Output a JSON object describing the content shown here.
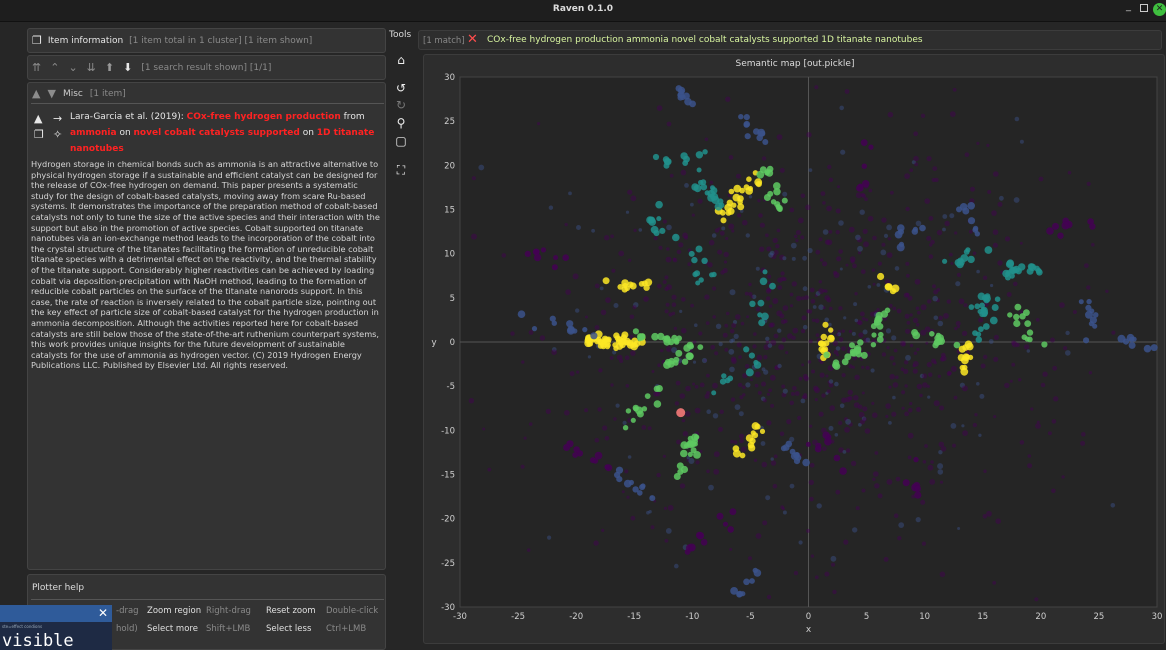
{
  "window": {
    "title": "Raven 0.1.0"
  },
  "info_header": {
    "label": "Item information",
    "summary": "[1 item total in 1 cluster] [1 item shown]"
  },
  "nav": {
    "results": "[1 search result shown] [1/1]"
  },
  "item_panel": {
    "group_label": "Misc",
    "group_count": "[1 item]",
    "authors_year": "Lara-Garcia et al. (2019): ",
    "title_parts": [
      {
        "text": "COx-free hydrogen production",
        "highlight": true
      },
      {
        "text": " from ",
        "highlight": false
      },
      {
        "text": "ammonia",
        "highlight": true
      },
      {
        "text": " on ",
        "highlight": false
      },
      {
        "text": "novel cobalt catalysts supported",
        "highlight": true
      },
      {
        "text": " on ",
        "highlight": false
      },
      {
        "text": "1D titanate nanotubes",
        "highlight": true
      }
    ],
    "abstract": "Hydrogen storage in chemical bonds such as ammonia is an attractive alternative to physical hydrogen storage if a sustainable and efficient catalyst can be designed for the release of COx-free hydrogen on demand. This paper presents a systematic study for the design of cobalt-based catalysts, moving away from scare Ru-based systems. It demonstrates the importance of the preparation method of cobalt-based catalysts not only to tune the size of the active species and their interaction with the support but also in the promotion of active species. Cobalt supported on titanate nanotubes via an ion-exchange method leads to the incorporation of the cobalt into the crystal structure of the titanates facilitating the formation of unreducible cobalt titanate species with a detrimental effect on the reactivity, and the thermal stability of the titanate support. Considerably higher reactivities can be achieved by loading cobalt via deposition-precipitation with NaOH method, leading to the formation of reducible cobalt particles on the surface of the titanate nanorods support. In this case, the rate of reaction is inversely related to the cobalt particle size, pointing out the key effect of particle size of cobalt-based catalyst for the hydrogen production in ammonia decomposition. Although the activities reported here for cobalt-based catalysts are still below those of the state-of-the-art ruthenium counterpart systems, this work provides unique insights for the future development of sustainable catalysts for the use of ammonia as hydrogen vector. (C) 2019 Hydrogen Energy Publications LLC. Published by Elsevier Ltd. All rights reserved."
  },
  "help": {
    "title": "Plotter help",
    "row1": [
      {
        "text": "-drag"
      },
      {
        "text": "Zoom region"
      },
      {
        "text": "Right-drag"
      },
      {
        "text": "Reset zoom"
      },
      {
        "text": "Double-click"
      }
    ],
    "row2": [
      {
        "text": "hold)"
      },
      {
        "text": "Select more"
      },
      {
        "text": "Shift+LMB"
      },
      {
        "text": "Select less"
      },
      {
        "text": "Ctrl+LMB"
      }
    ]
  },
  "tools": {
    "label": "Tools"
  },
  "search": {
    "count": "[1 match]",
    "query": "COx-free hydrogen production ammonia novel cobalt catalysts supported 1D titanate nanotubes"
  },
  "mini_window": {
    "tiny_text": "ste=effect     condions",
    "big_text": "visible"
  },
  "chart_data": {
    "type": "scatter",
    "title": "Semantic map [out.pickle]",
    "xlabel": "x",
    "ylabel": "y",
    "xlim": [
      -30,
      30
    ],
    "ylim": [
      -30,
      30
    ],
    "xticks": [
      -30,
      -25,
      -20,
      -15,
      -10,
      -5,
      0,
      5,
      10,
      15,
      20,
      25,
      30
    ],
    "yticks": [
      30,
      25,
      20,
      15,
      10,
      5,
      0,
      -5,
      -10,
      -15,
      -20,
      -25,
      -30
    ],
    "grid": false,
    "colormap": [
      "#440154",
      "#3b528b",
      "#21918c",
      "#5ec962",
      "#fde725"
    ],
    "highlight_color": "#e07070",
    "selected_point": {
      "x": -11,
      "y": -8
    },
    "clusters": [
      {
        "x": -16.5,
        "y": 0,
        "n": 40,
        "s": 1.5,
        "c": 4
      },
      {
        "x": -19,
        "y": 0,
        "n": 10,
        "s": 0.6,
        "c": 4
      },
      {
        "x": -15.5,
        "y": 6.5,
        "n": 12,
        "s": 1.2,
        "c": 4
      },
      {
        "x": -13,
        "y": 0.5,
        "n": 16,
        "s": 1.4,
        "c": 3
      },
      {
        "x": -11,
        "y": -1.5,
        "n": 14,
        "s": 1.2,
        "c": 3
      },
      {
        "x": -6,
        "y": 16.5,
        "n": 22,
        "s": 1.6,
        "c": 4
      },
      {
        "x": -3,
        "y": 17,
        "n": 16,
        "s": 1.6,
        "c": 3
      },
      {
        "x": -8.5,
        "y": 17,
        "n": 16,
        "s": 1.6,
        "c": 2
      },
      {
        "x": -10,
        "y": 21,
        "n": 10,
        "s": 1.6,
        "c": 2
      },
      {
        "x": -13,
        "y": 13,
        "n": 10,
        "s": 1.8,
        "c": 2
      },
      {
        "x": -10.5,
        "y": 27.5,
        "n": 10,
        "s": 1.0,
        "c": 1
      },
      {
        "x": -5,
        "y": 24,
        "n": 10,
        "s": 1.5,
        "c": 1
      },
      {
        "x": -9,
        "y": 8,
        "n": 10,
        "s": 2.0,
        "c": 2
      },
      {
        "x": -14,
        "y": -7,
        "n": 12,
        "s": 1.6,
        "c": 3
      },
      {
        "x": -10.5,
        "y": -13,
        "n": 18,
        "s": 1.6,
        "c": 3
      },
      {
        "x": -5,
        "y": -11,
        "n": 12,
        "s": 1.4,
        "c": 4
      },
      {
        "x": -1.5,
        "y": -12.5,
        "n": 10,
        "s": 1.2,
        "c": 1
      },
      {
        "x": -15,
        "y": -16,
        "n": 10,
        "s": 2.0,
        "c": 1
      },
      {
        "x": -19,
        "y": -13,
        "n": 10,
        "s": 1.6,
        "c": 0
      },
      {
        "x": -8,
        "y": -22,
        "n": 10,
        "s": 2.0,
        "c": 0
      },
      {
        "x": -5,
        "y": -27,
        "n": 8,
        "s": 1.6,
        "c": 1
      },
      {
        "x": 1.5,
        "y": 0,
        "n": 14,
        "s": 1.2,
        "c": 4
      },
      {
        "x": 3.5,
        "y": -1.5,
        "n": 14,
        "s": 1.4,
        "c": 3
      },
      {
        "x": 6,
        "y": 1,
        "n": 14,
        "s": 1.8,
        "c": 3
      },
      {
        "x": 11,
        "y": 0.5,
        "n": 12,
        "s": 1.4,
        "c": 3
      },
      {
        "x": 13.5,
        "y": -2,
        "n": 12,
        "s": 1.2,
        "c": 4
      },
      {
        "x": 15,
        "y": 3,
        "n": 22,
        "s": 1.8,
        "c": 2
      },
      {
        "x": 19,
        "y": 8,
        "n": 18,
        "s": 1.8,
        "c": 2
      },
      {
        "x": 14,
        "y": 10,
        "n": 10,
        "s": 1.6,
        "c": 2
      },
      {
        "x": 18.5,
        "y": 2,
        "n": 12,
        "s": 1.6,
        "c": 3
      },
      {
        "x": 24,
        "y": 3,
        "n": 10,
        "s": 2.0,
        "c": 1
      },
      {
        "x": 28,
        "y": 0,
        "n": 8,
        "s": 1.6,
        "c": 1
      },
      {
        "x": 8,
        "y": 12,
        "n": 8,
        "s": 2.0,
        "c": 1
      },
      {
        "x": 7,
        "y": 6.5,
        "n": 6,
        "s": 1.0,
        "c": 4
      },
      {
        "x": 14,
        "y": 14,
        "n": 8,
        "s": 2.0,
        "c": 1
      },
      {
        "x": 23,
        "y": 13,
        "n": 8,
        "s": 2.0,
        "c": 0
      },
      {
        "x": 2,
        "y": -13,
        "n": 8,
        "s": 2.0,
        "c": 0
      },
      {
        "x": 9,
        "y": -16,
        "n": 6,
        "s": 2.0,
        "c": 0
      },
      {
        "x": -22,
        "y": 2,
        "n": 10,
        "s": 2.0,
        "c": 1
      },
      {
        "x": -23,
        "y": 10,
        "n": 8,
        "s": 2.0,
        "c": 0
      },
      {
        "x": 5,
        "y": 20,
        "n": 6,
        "s": 2.0,
        "c": 0
      },
      {
        "x": -4,
        "y": 5,
        "n": 8,
        "s": 2.0,
        "c": 2
      },
      {
        "x": -6,
        "y": -3,
        "n": 10,
        "s": 2.0,
        "c": 2
      }
    ]
  }
}
